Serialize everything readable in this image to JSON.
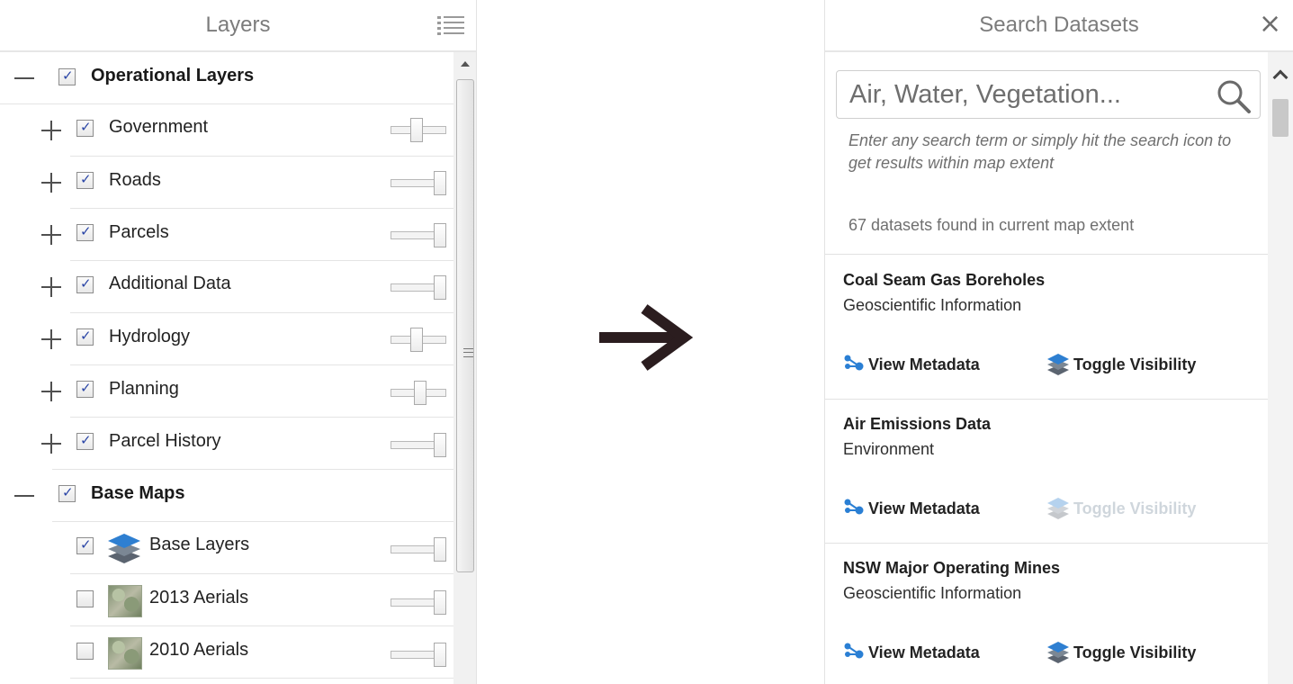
{
  "layers_panel": {
    "title": "Layers",
    "groups": [
      {
        "label": "Operational Layers",
        "checked": true,
        "expanded": true,
        "layers": [
          {
            "label": "Government",
            "checked": true,
            "opacity": 0.45
          },
          {
            "label": "Roads",
            "checked": true,
            "opacity": 1.0
          },
          {
            "label": "Parcels",
            "checked": true,
            "opacity": 1.0
          },
          {
            "label": "Additional Data",
            "checked": true,
            "opacity": 1.0
          },
          {
            "label": "Hydrology",
            "checked": true,
            "opacity": 0.45
          },
          {
            "label": "Planning",
            "checked": true,
            "opacity": 0.55
          },
          {
            "label": "Parcel History",
            "checked": true,
            "opacity": 1.0
          }
        ]
      },
      {
        "label": "Base Maps",
        "checked": true,
        "expanded": true,
        "layers": [
          {
            "label": "Base Layers",
            "checked": true,
            "icon": "layers-stack-icon",
            "opacity": 1.0
          },
          {
            "label": "2013 Aerials",
            "checked": false,
            "icon": "aerial-thumbnail",
            "opacity": 1.0
          },
          {
            "label": "2010 Aerials",
            "checked": false,
            "icon": "aerial-thumbnail",
            "opacity": 1.0
          }
        ]
      }
    ]
  },
  "search_panel": {
    "title": "Search Datasets",
    "search": {
      "placeholder": "Air, Water, Vegetation...",
      "value": ""
    },
    "hint": "Enter any search term or simply hit the search icon to get results within map extent",
    "result_count": "67 datasets found in current map extent",
    "results": [
      {
        "title": "Coal Seam Gas Boreholes",
        "category": "Geoscientific Information",
        "metadata_label": "View Metadata",
        "toggle_label": "Toggle Visibility",
        "toggle_enabled": true
      },
      {
        "title": "Air Emissions Data",
        "category": "Environment",
        "metadata_label": "View Metadata",
        "toggle_label": "Toggle Visibility",
        "toggle_enabled": false
      },
      {
        "title": "NSW Major Operating Mines",
        "category": "Geoscientific Information",
        "metadata_label": "View Metadata",
        "toggle_label": "Toggle Visibility",
        "toggle_enabled": true
      }
    ]
  },
  "colors": {
    "accent_blue": "#2a7fd4",
    "checkbox_tick": "#2a45a6",
    "arrow": "#2b1d1f",
    "disabled_text": "#cfd6dc"
  },
  "icons": {
    "list": "list-icon",
    "close": "close-icon",
    "search": "search-icon",
    "metadata": "metadata-icon",
    "toggle": "layers-stack-icon",
    "arrow": "right-arrow-icon"
  }
}
